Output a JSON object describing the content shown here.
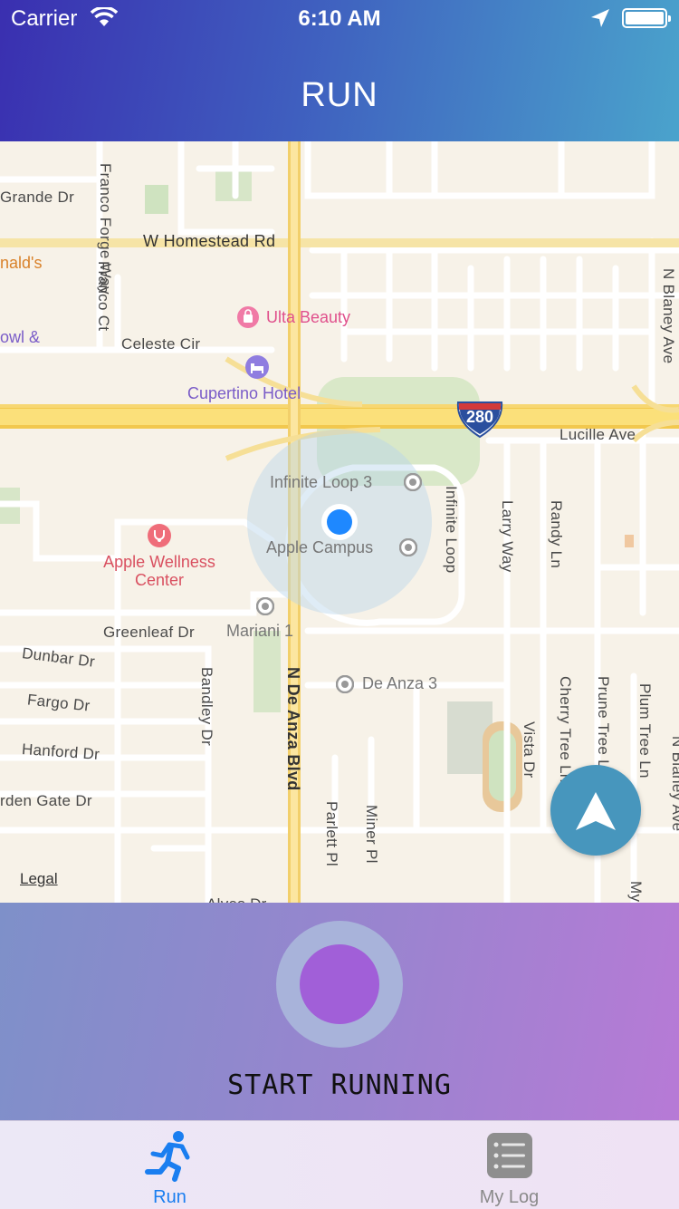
{
  "status_bar": {
    "carrier": "Carrier",
    "time": "6:10 AM"
  },
  "header": {
    "title": "RUN"
  },
  "map": {
    "streets": {
      "grande_dr": "Grande Dr",
      "franco_forge_way": "Franco Forge Way",
      "w_homestead_rd": "W Homestead Rd",
      "franco_ct": "Franco Ct",
      "celeste_cir": "Celeste Cir",
      "n_blaney_ave": "N Blaney Ave",
      "lucille_ave": "Lucille Ave",
      "infinite_loop": "Infinite Loop",
      "larry_way": "Larry Way",
      "randy_ln": "Randy Ln",
      "greenleaf_dr": "Greenleaf Dr",
      "dunbar_dr": "Dunbar Dr",
      "fargo_dr": "Fargo Dr",
      "hanford_dr": "Hanford Dr",
      "garden_gate_dr": "rden Gate Dr",
      "bandley_dr": "Bandley Dr",
      "n_de_anza_blvd": "N De Anza Blvd",
      "vista_dr": "Vista Dr",
      "cherry_tree_ln": "Cherry Tree Ln",
      "prune_tree_ln": "Prune Tree Ln",
      "plum_tree_ln": "Plum Tree Ln",
      "n_blaney_ave_2": "N Blaney Ave",
      "parlett_pl": "Parlett Pl",
      "miner_pl": "Miner Pl",
      "alves_dr": "Alves Dr",
      "my": "My"
    },
    "pois": {
      "mcdonalds": "nald's",
      "bowl": "owl &",
      "ulta": "Ulta Beauty",
      "cupertino_hotel": "Cupertino Hotel",
      "infinite_loop_3": "Infinite Loop 3",
      "apple_campus": "Apple Campus",
      "apple_wellness_1": "Apple Wellness",
      "apple_wellness_2": "Center",
      "mariani_1": "Mariani 1",
      "de_anza_3": "De Anza 3"
    },
    "highway_shield": "280",
    "legal": "Legal"
  },
  "run_panel": {
    "start_label": "START RUNNING"
  },
  "tab_bar": {
    "tabs": [
      {
        "label": "Run",
        "active": true,
        "icon": "runner-icon"
      },
      {
        "label": "My Log",
        "active": false,
        "icon": "list-icon"
      }
    ]
  },
  "colors": {
    "active_tab": "#1a7ef0",
    "run_button": "#a15fd8",
    "user_location": "#1e88ff"
  }
}
